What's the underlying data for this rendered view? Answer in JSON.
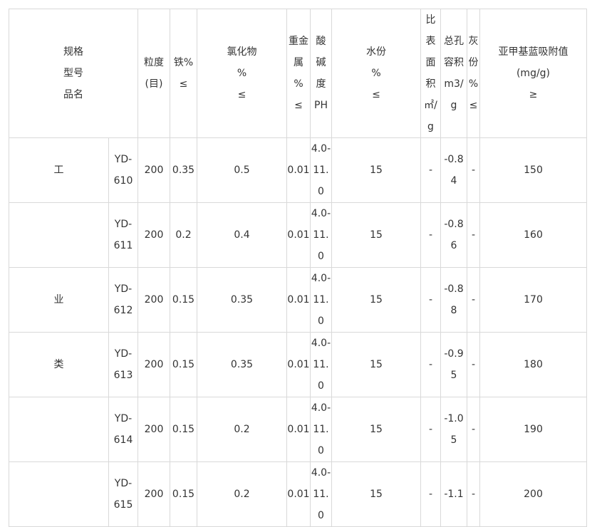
{
  "headers": {
    "spec": [
      "规格",
      "型号",
      "品名"
    ],
    "particle": [
      "粒度",
      "(目)"
    ],
    "iron": "铁%≤",
    "chloride": [
      "氯化物",
      "%",
      "≤"
    ],
    "heavy_metal": [
      "重金",
      "属",
      "%",
      "≤"
    ],
    "ph": [
      "酸",
      "碱",
      "度",
      "PH"
    ],
    "moisture": [
      "水份",
      "%",
      "≤"
    ],
    "surface_area": [
      "比",
      "表",
      "面",
      "积",
      "㎡/g"
    ],
    "pore_volume": [
      "总孔",
      "容积",
      "m3/g"
    ],
    "ash": [
      "灰",
      "份",
      "%",
      "≤"
    ],
    "methylene_blue": [
      "亚甲基蓝吸附值",
      "(mg/g)",
      "≥"
    ]
  },
  "category_chars": [
    "工",
    "",
    "业",
    "类",
    "",
    ""
  ],
  "rows": [
    {
      "model": [
        "YD-",
        "610"
      ],
      "particle": "200",
      "iron": "0.35",
      "chloride": "0.5",
      "heavy_metal": "0.01",
      "ph": [
        "4.0-",
        "11.0"
      ],
      "moisture": "15",
      "surface_area": "-",
      "pore_volume": "-0.84",
      "ash": "-",
      "methylene_blue": "150"
    },
    {
      "model": [
        "YD-",
        "611"
      ],
      "particle": "200",
      "iron": "0.2",
      "chloride": "0.4",
      "heavy_metal": "0.01",
      "ph": [
        "4.0-",
        "11.0"
      ],
      "moisture": "15",
      "surface_area": "-",
      "pore_volume": "-0.86",
      "ash": "-",
      "methylene_blue": "160"
    },
    {
      "model": [
        "YD-",
        "612"
      ],
      "particle": "200",
      "iron": "0.15",
      "chloride": "0.35",
      "heavy_metal": "0.01",
      "ph": [
        "4.0-",
        "11.0"
      ],
      "moisture": "15",
      "surface_area": "-",
      "pore_volume": "-0.88",
      "ash": "-",
      "methylene_blue": "170"
    },
    {
      "model": [
        "YD-",
        "613"
      ],
      "particle": "200",
      "iron": "0.15",
      "chloride": "0.35",
      "heavy_metal": "0.01",
      "ph": [
        "4.0-",
        "11.0"
      ],
      "moisture": "15",
      "surface_area": "-",
      "pore_volume": "-0.95",
      "ash": "-",
      "methylene_blue": "180"
    },
    {
      "model": [
        "YD-",
        "614"
      ],
      "particle": "200",
      "iron": "0.15",
      "chloride": "0.2",
      "heavy_metal": "0.01",
      "ph": [
        "4.0-",
        "11.0"
      ],
      "moisture": "15",
      "surface_area": "-",
      "pore_volume": "-1.05",
      "ash": "-",
      "methylene_blue": "190"
    },
    {
      "model": [
        "YD-",
        "615"
      ],
      "particle": "200",
      "iron": "0.15",
      "chloride": "0.2",
      "heavy_metal": "0.01",
      "ph": [
        "4.0-",
        "11.0"
      ],
      "moisture": "15",
      "surface_area": "-",
      "pore_volume": "-1.1",
      "ash": "-",
      "methylene_blue": "200"
    }
  ]
}
